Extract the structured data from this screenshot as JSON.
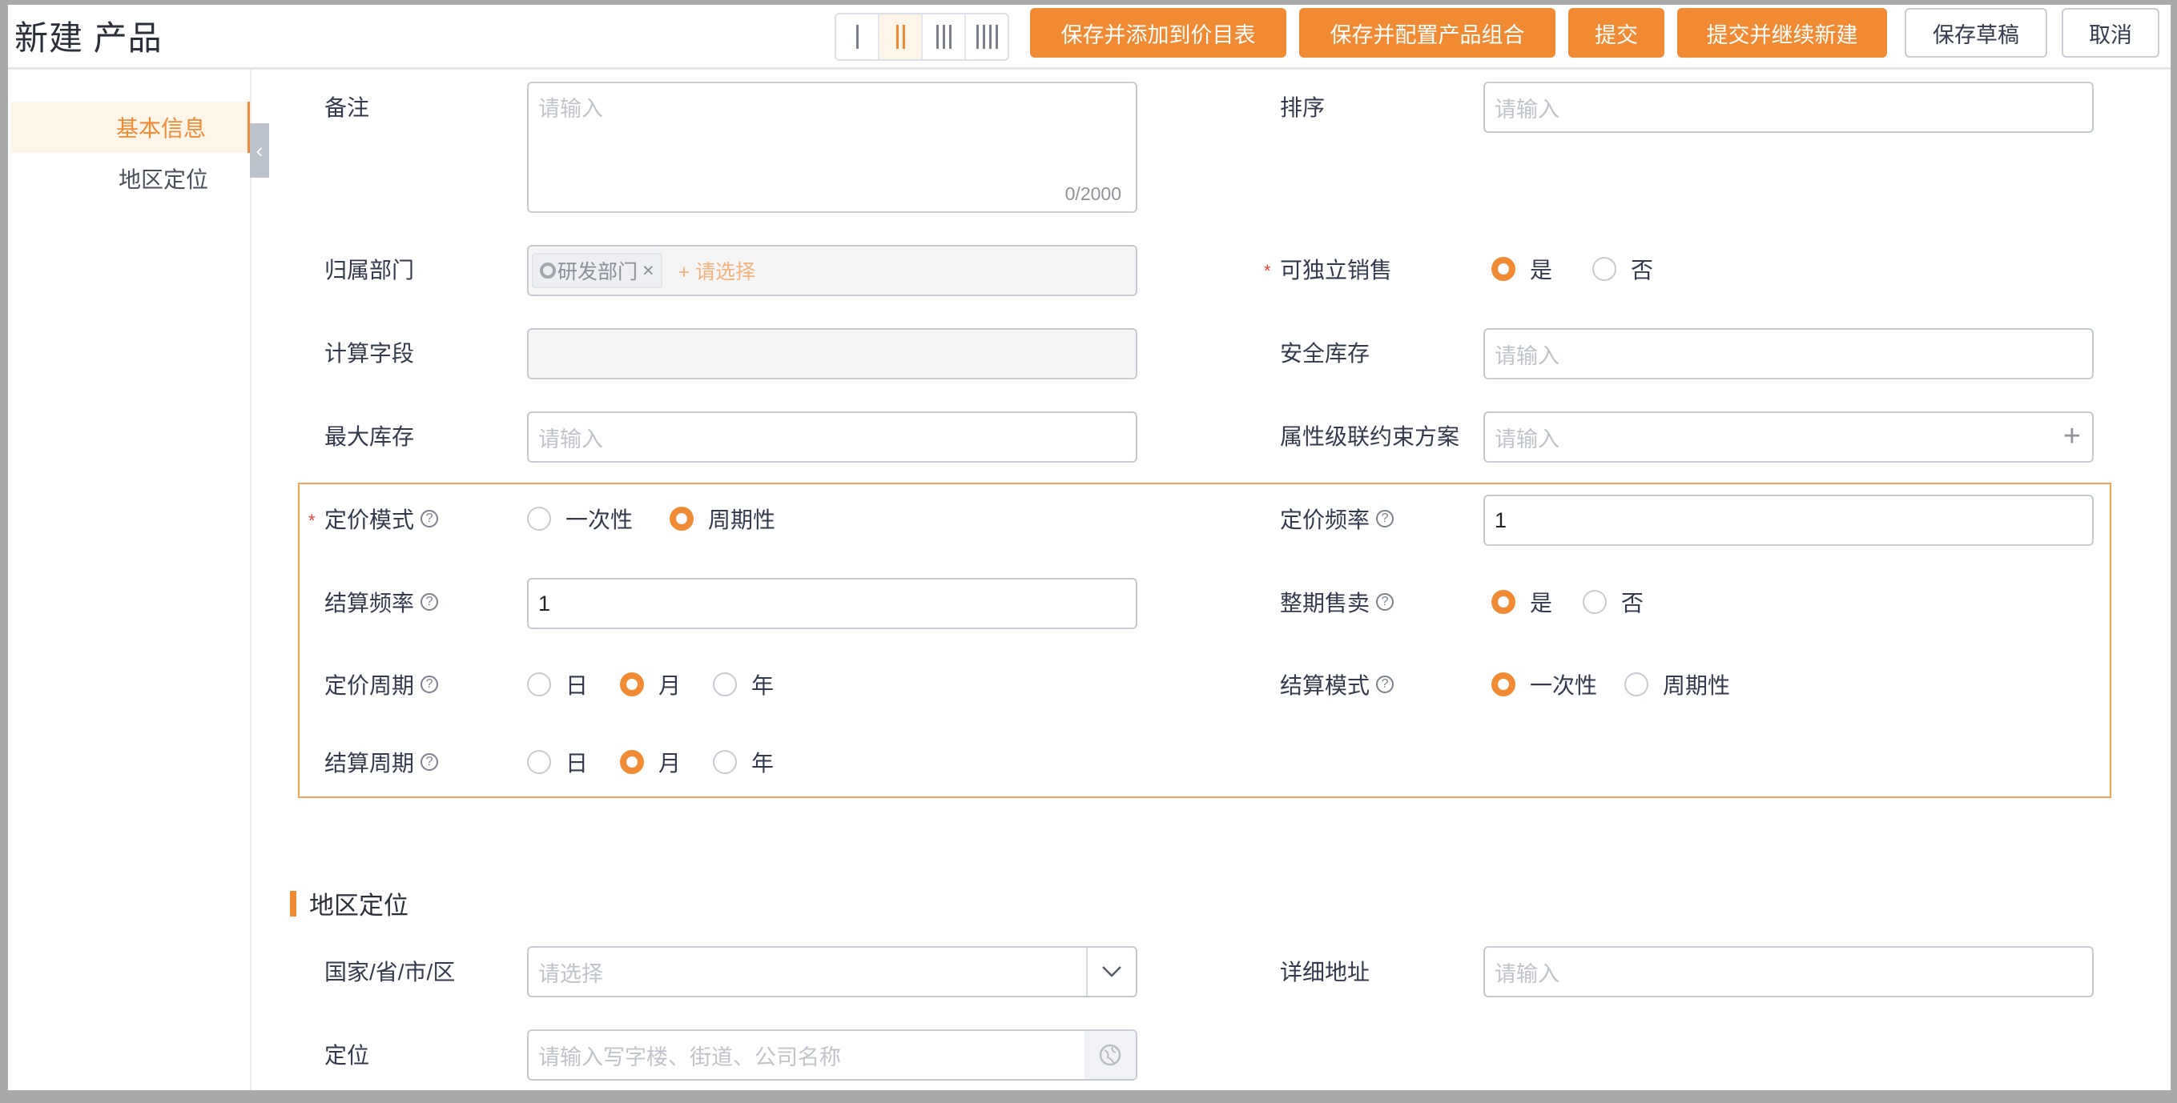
{
  "header": {
    "title": "新建 产品",
    "column_options": [
      "1",
      "2",
      "3",
      "4"
    ],
    "column_selected": 2,
    "buttons": {
      "save_add_pricelist": "保存并添加到价目表",
      "save_config_bundle": "保存并配置产品组合",
      "submit": "提交",
      "submit_new": "提交并继续新建",
      "save_draft": "保存草稿",
      "cancel": "取消"
    }
  },
  "sidebar": {
    "items": [
      {
        "label": "基本信息",
        "active": true
      },
      {
        "label": "地区定位",
        "active": false
      }
    ]
  },
  "form": {
    "remark": {
      "label": "备注",
      "placeholder": "请输入",
      "counter": "0/2000"
    },
    "sort": {
      "label": "排序",
      "placeholder": "请输入"
    },
    "department": {
      "label": "归属部门",
      "tag": "研发部门",
      "add_placeholder": "+ 请选择"
    },
    "independent_sale": {
      "label": "可独立销售",
      "required": true,
      "options": [
        "是",
        "否"
      ],
      "selected": "是"
    },
    "calc_field": {
      "label": "计算字段",
      "value": ""
    },
    "safety_stock": {
      "label": "安全库存",
      "placeholder": "请输入"
    },
    "max_stock": {
      "label": "最大库存",
      "placeholder": "请输入"
    },
    "attr_constraint": {
      "label": "属性级联约束方案",
      "placeholder": "请输入"
    },
    "pricing_mode": {
      "label": "定价模式",
      "required": true,
      "options": [
        "一次性",
        "周期性"
      ],
      "selected": "周期性"
    },
    "pricing_freq": {
      "label": "定价频率",
      "value": "1"
    },
    "settle_freq": {
      "label": "结算频率",
      "value": "1"
    },
    "whole_period": {
      "label": "整期售卖",
      "options": [
        "是",
        "否"
      ],
      "selected": "是"
    },
    "pricing_cycle": {
      "label": "定价周期",
      "options": [
        "日",
        "月",
        "年"
      ],
      "selected": "月"
    },
    "settle_mode": {
      "label": "结算模式",
      "options": [
        "一次性",
        "周期性"
      ],
      "selected": "一次性"
    },
    "settle_cycle": {
      "label": "结算周期",
      "options": [
        "日",
        "月",
        "年"
      ],
      "selected": "月"
    }
  },
  "region": {
    "section_title": "地区定位",
    "area": {
      "label": "国家/省/市/区",
      "placeholder": "请选择"
    },
    "address": {
      "label": "详细地址",
      "placeholder": "请输入"
    },
    "location": {
      "label": "定位",
      "placeholder": "请输入写字楼、街道、公司名称"
    }
  },
  "colors": {
    "accent": "#f08a33",
    "required": "#e5443b",
    "frame": "#f0a450"
  }
}
